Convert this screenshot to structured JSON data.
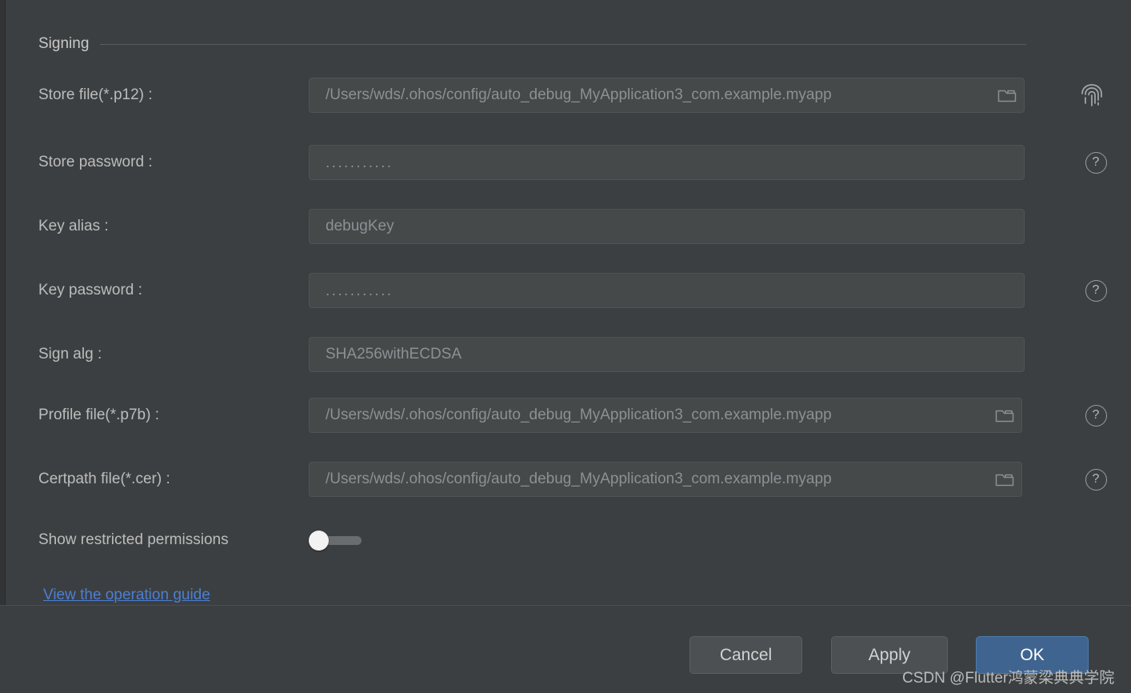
{
  "section": {
    "title": "Signing"
  },
  "fields": [
    {
      "label": "Store file(*.p12) :",
      "value": "/Users/wds/.ohos/config/auto_debug_MyApplication3_com.example.myapp",
      "kind": "file",
      "browse_icon": "folder-icon",
      "trailing_icon": "fingerprint-icon"
    },
    {
      "label": "Store password :",
      "value": "...........",
      "kind": "password",
      "browse_icon": "",
      "trailing_icon": "help-icon"
    },
    {
      "label": "Key alias :",
      "value": "debugKey",
      "kind": "text",
      "browse_icon": "",
      "trailing_icon": ""
    },
    {
      "label": "Key password :",
      "value": "...........",
      "kind": "password",
      "browse_icon": "",
      "trailing_icon": "help-icon"
    },
    {
      "label": "Sign alg :",
      "value": "SHA256withECDSA",
      "kind": "text",
      "browse_icon": "",
      "trailing_icon": ""
    },
    {
      "label": "Profile file(*.p7b) :",
      "value": "/Users/wds/.ohos/config/auto_debug_MyApplication3_com.example.myapp",
      "kind": "file",
      "browse_icon": "folder-icon",
      "trailing_icon": "help-icon"
    },
    {
      "label": "Certpath file(*.cer) :",
      "value": "/Users/wds/.ohos/config/auto_debug_MyApplication3_com.example.myapp",
      "kind": "file",
      "browse_icon": "folder-icon",
      "trailing_icon": "help-icon"
    }
  ],
  "toggle_row": {
    "label": "Show restricted permissions",
    "state": "off"
  },
  "link": {
    "label": "View the operation guide"
  },
  "buttons": {
    "cancel": "Cancel",
    "apply": "Apply",
    "ok": "OK"
  },
  "watermark": {
    "text": "CSDN @Flutter鸿蒙梁典典学院"
  },
  "icons": {
    "help": "?"
  },
  "colors": {
    "background": "#3c3f41",
    "field_background": "#45494a",
    "accent": "#3f648f",
    "link": "#4b7fd4"
  }
}
